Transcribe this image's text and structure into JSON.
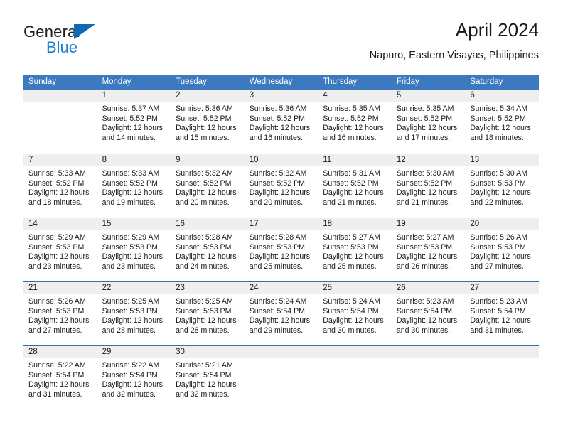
{
  "logo": {
    "word_one": "General",
    "word_two": "Blue",
    "triangle_color": "#1268b3",
    "blue_color": "#1b7fd4"
  },
  "header": {
    "title": "April 2024",
    "subtitle": "Napuro, Eastern Visayas, Philippines"
  },
  "theme": {
    "header_blue": "#3c79bf",
    "row_divider_blue": "#2f6fb5",
    "day_band_gray": "#efefef"
  },
  "calendar": {
    "weekday_headers": [
      "Sunday",
      "Monday",
      "Tuesday",
      "Wednesday",
      "Thursday",
      "Friday",
      "Saturday"
    ],
    "weeks": [
      [
        {
          "day": "",
          "sunrise": "",
          "sunset": "",
          "daylight_line1": "",
          "daylight_line2": ""
        },
        {
          "day": "1",
          "sunrise": "Sunrise: 5:37 AM",
          "sunset": "Sunset: 5:52 PM",
          "daylight_line1": "Daylight: 12 hours",
          "daylight_line2": "and 14 minutes."
        },
        {
          "day": "2",
          "sunrise": "Sunrise: 5:36 AM",
          "sunset": "Sunset: 5:52 PM",
          "daylight_line1": "Daylight: 12 hours",
          "daylight_line2": "and 15 minutes."
        },
        {
          "day": "3",
          "sunrise": "Sunrise: 5:36 AM",
          "sunset": "Sunset: 5:52 PM",
          "daylight_line1": "Daylight: 12 hours",
          "daylight_line2": "and 16 minutes."
        },
        {
          "day": "4",
          "sunrise": "Sunrise: 5:35 AM",
          "sunset": "Sunset: 5:52 PM",
          "daylight_line1": "Daylight: 12 hours",
          "daylight_line2": "and 16 minutes."
        },
        {
          "day": "5",
          "sunrise": "Sunrise: 5:35 AM",
          "sunset": "Sunset: 5:52 PM",
          "daylight_line1": "Daylight: 12 hours",
          "daylight_line2": "and 17 minutes."
        },
        {
          "day": "6",
          "sunrise": "Sunrise: 5:34 AM",
          "sunset": "Sunset: 5:52 PM",
          "daylight_line1": "Daylight: 12 hours",
          "daylight_line2": "and 18 minutes."
        }
      ],
      [
        {
          "day": "7",
          "sunrise": "Sunrise: 5:33 AM",
          "sunset": "Sunset: 5:52 PM",
          "daylight_line1": "Daylight: 12 hours",
          "daylight_line2": "and 18 minutes."
        },
        {
          "day": "8",
          "sunrise": "Sunrise: 5:33 AM",
          "sunset": "Sunset: 5:52 PM",
          "daylight_line1": "Daylight: 12 hours",
          "daylight_line2": "and 19 minutes."
        },
        {
          "day": "9",
          "sunrise": "Sunrise: 5:32 AM",
          "sunset": "Sunset: 5:52 PM",
          "daylight_line1": "Daylight: 12 hours",
          "daylight_line2": "and 20 minutes."
        },
        {
          "day": "10",
          "sunrise": "Sunrise: 5:32 AM",
          "sunset": "Sunset: 5:52 PM",
          "daylight_line1": "Daylight: 12 hours",
          "daylight_line2": "and 20 minutes."
        },
        {
          "day": "11",
          "sunrise": "Sunrise: 5:31 AM",
          "sunset": "Sunset: 5:52 PM",
          "daylight_line1": "Daylight: 12 hours",
          "daylight_line2": "and 21 minutes."
        },
        {
          "day": "12",
          "sunrise": "Sunrise: 5:30 AM",
          "sunset": "Sunset: 5:52 PM",
          "daylight_line1": "Daylight: 12 hours",
          "daylight_line2": "and 21 minutes."
        },
        {
          "day": "13",
          "sunrise": "Sunrise: 5:30 AM",
          "sunset": "Sunset: 5:53 PM",
          "daylight_line1": "Daylight: 12 hours",
          "daylight_line2": "and 22 minutes."
        }
      ],
      [
        {
          "day": "14",
          "sunrise": "Sunrise: 5:29 AM",
          "sunset": "Sunset: 5:53 PM",
          "daylight_line1": "Daylight: 12 hours",
          "daylight_line2": "and 23 minutes."
        },
        {
          "day": "15",
          "sunrise": "Sunrise: 5:29 AM",
          "sunset": "Sunset: 5:53 PM",
          "daylight_line1": "Daylight: 12 hours",
          "daylight_line2": "and 23 minutes."
        },
        {
          "day": "16",
          "sunrise": "Sunrise: 5:28 AM",
          "sunset": "Sunset: 5:53 PM",
          "daylight_line1": "Daylight: 12 hours",
          "daylight_line2": "and 24 minutes."
        },
        {
          "day": "17",
          "sunrise": "Sunrise: 5:28 AM",
          "sunset": "Sunset: 5:53 PM",
          "daylight_line1": "Daylight: 12 hours",
          "daylight_line2": "and 25 minutes."
        },
        {
          "day": "18",
          "sunrise": "Sunrise: 5:27 AM",
          "sunset": "Sunset: 5:53 PM",
          "daylight_line1": "Daylight: 12 hours",
          "daylight_line2": "and 25 minutes."
        },
        {
          "day": "19",
          "sunrise": "Sunrise: 5:27 AM",
          "sunset": "Sunset: 5:53 PM",
          "daylight_line1": "Daylight: 12 hours",
          "daylight_line2": "and 26 minutes."
        },
        {
          "day": "20",
          "sunrise": "Sunrise: 5:26 AM",
          "sunset": "Sunset: 5:53 PM",
          "daylight_line1": "Daylight: 12 hours",
          "daylight_line2": "and 27 minutes."
        }
      ],
      [
        {
          "day": "21",
          "sunrise": "Sunrise: 5:26 AM",
          "sunset": "Sunset: 5:53 PM",
          "daylight_line1": "Daylight: 12 hours",
          "daylight_line2": "and 27 minutes."
        },
        {
          "day": "22",
          "sunrise": "Sunrise: 5:25 AM",
          "sunset": "Sunset: 5:53 PM",
          "daylight_line1": "Daylight: 12 hours",
          "daylight_line2": "and 28 minutes."
        },
        {
          "day": "23",
          "sunrise": "Sunrise: 5:25 AM",
          "sunset": "Sunset: 5:53 PM",
          "daylight_line1": "Daylight: 12 hours",
          "daylight_line2": "and 28 minutes."
        },
        {
          "day": "24",
          "sunrise": "Sunrise: 5:24 AM",
          "sunset": "Sunset: 5:54 PM",
          "daylight_line1": "Daylight: 12 hours",
          "daylight_line2": "and 29 minutes."
        },
        {
          "day": "25",
          "sunrise": "Sunrise: 5:24 AM",
          "sunset": "Sunset: 5:54 PM",
          "daylight_line1": "Daylight: 12 hours",
          "daylight_line2": "and 30 minutes."
        },
        {
          "day": "26",
          "sunrise": "Sunrise: 5:23 AM",
          "sunset": "Sunset: 5:54 PM",
          "daylight_line1": "Daylight: 12 hours",
          "daylight_line2": "and 30 minutes."
        },
        {
          "day": "27",
          "sunrise": "Sunrise: 5:23 AM",
          "sunset": "Sunset: 5:54 PM",
          "daylight_line1": "Daylight: 12 hours",
          "daylight_line2": "and 31 minutes."
        }
      ],
      [
        {
          "day": "28",
          "sunrise": "Sunrise: 5:22 AM",
          "sunset": "Sunset: 5:54 PM",
          "daylight_line1": "Daylight: 12 hours",
          "daylight_line2": "and 31 minutes."
        },
        {
          "day": "29",
          "sunrise": "Sunrise: 5:22 AM",
          "sunset": "Sunset: 5:54 PM",
          "daylight_line1": "Daylight: 12 hours",
          "daylight_line2": "and 32 minutes."
        },
        {
          "day": "30",
          "sunrise": "Sunrise: 5:21 AM",
          "sunset": "Sunset: 5:54 PM",
          "daylight_line1": "Daylight: 12 hours",
          "daylight_line2": "and 32 minutes."
        },
        {
          "day": "",
          "sunrise": "",
          "sunset": "",
          "daylight_line1": "",
          "daylight_line2": ""
        },
        {
          "day": "",
          "sunrise": "",
          "sunset": "",
          "daylight_line1": "",
          "daylight_line2": ""
        },
        {
          "day": "",
          "sunrise": "",
          "sunset": "",
          "daylight_line1": "",
          "daylight_line2": ""
        },
        {
          "day": "",
          "sunrise": "",
          "sunset": "",
          "daylight_line1": "",
          "daylight_line2": ""
        }
      ]
    ]
  }
}
